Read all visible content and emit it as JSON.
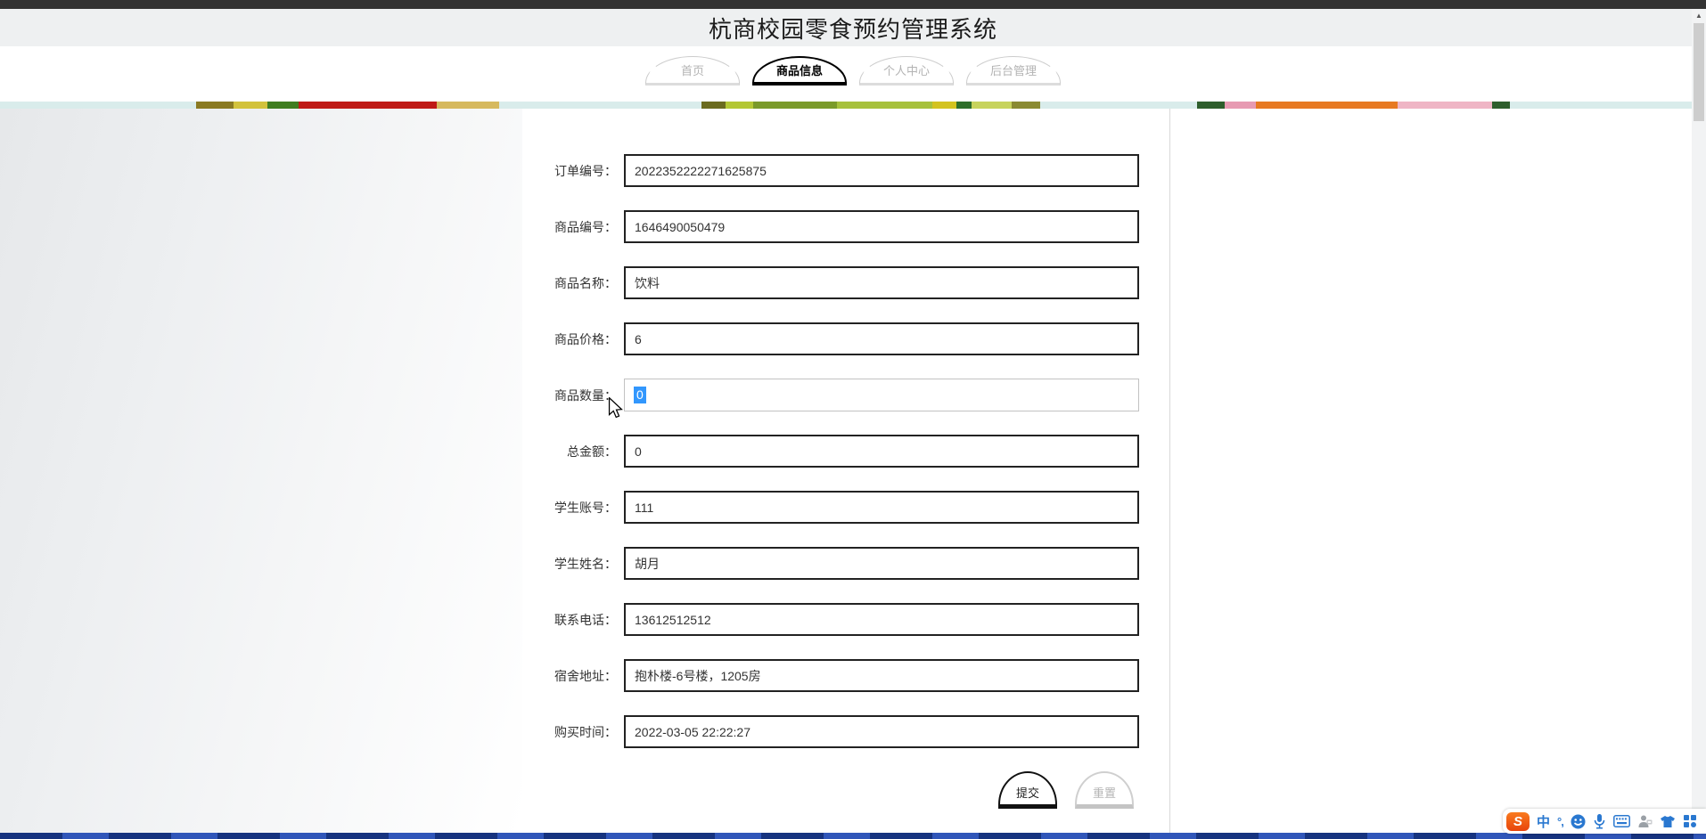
{
  "app": {
    "title": "杭商校园零食预约管理系统"
  },
  "nav": {
    "tabs": [
      {
        "name": "home",
        "label": "首页",
        "active": false
      },
      {
        "name": "product-info",
        "label": "商品信息",
        "active": true
      },
      {
        "name": "personal-center",
        "label": "个人中心",
        "active": false
      },
      {
        "name": "backend-admin",
        "label": "后台管理",
        "active": false
      }
    ]
  },
  "form": {
    "fields": [
      {
        "key": "order-number",
        "label": "订单编号：",
        "value": "2022352222271625875"
      },
      {
        "key": "product-number",
        "label": "商品编号：",
        "value": "1646490050479"
      },
      {
        "key": "product-name",
        "label": "商品名称：",
        "value": "饮料"
      },
      {
        "key": "product-price",
        "label": "商品价格：",
        "value": "6"
      },
      {
        "key": "product-quantity",
        "label": "商品数量：",
        "value": "0",
        "focused": true,
        "selected": true
      },
      {
        "key": "total-amount",
        "label": "总金额：",
        "value": "0"
      },
      {
        "key": "student-account",
        "label": "学生账号：",
        "value": "111"
      },
      {
        "key": "student-name",
        "label": "学生姓名：",
        "value": "胡月"
      },
      {
        "key": "contact-phone",
        "label": "联系电话：",
        "value": "13612512512"
      },
      {
        "key": "dorm-address",
        "label": "宿舍地址：",
        "value": "抱朴楼-6号楼，1205房"
      },
      {
        "key": "purchase-time",
        "label": "购买时间：",
        "value": "2022-03-05 22:22:27"
      }
    ],
    "buttons": {
      "submit": "提交",
      "reset": "重置"
    }
  },
  "colors": {
    "selection": "#3297fd",
    "taskbar_blue": "#1c3a92",
    "active_tab_border": "#000000"
  },
  "taskbar": {
    "ime": {
      "mode_label": "中",
      "punct_label": "°,",
      "icons": [
        "sogou-logo",
        "chinese-mode",
        "punctuation",
        "emoji",
        "voice-input",
        "soft-keyboard",
        "account-person",
        "skin",
        "toolbox"
      ]
    }
  }
}
